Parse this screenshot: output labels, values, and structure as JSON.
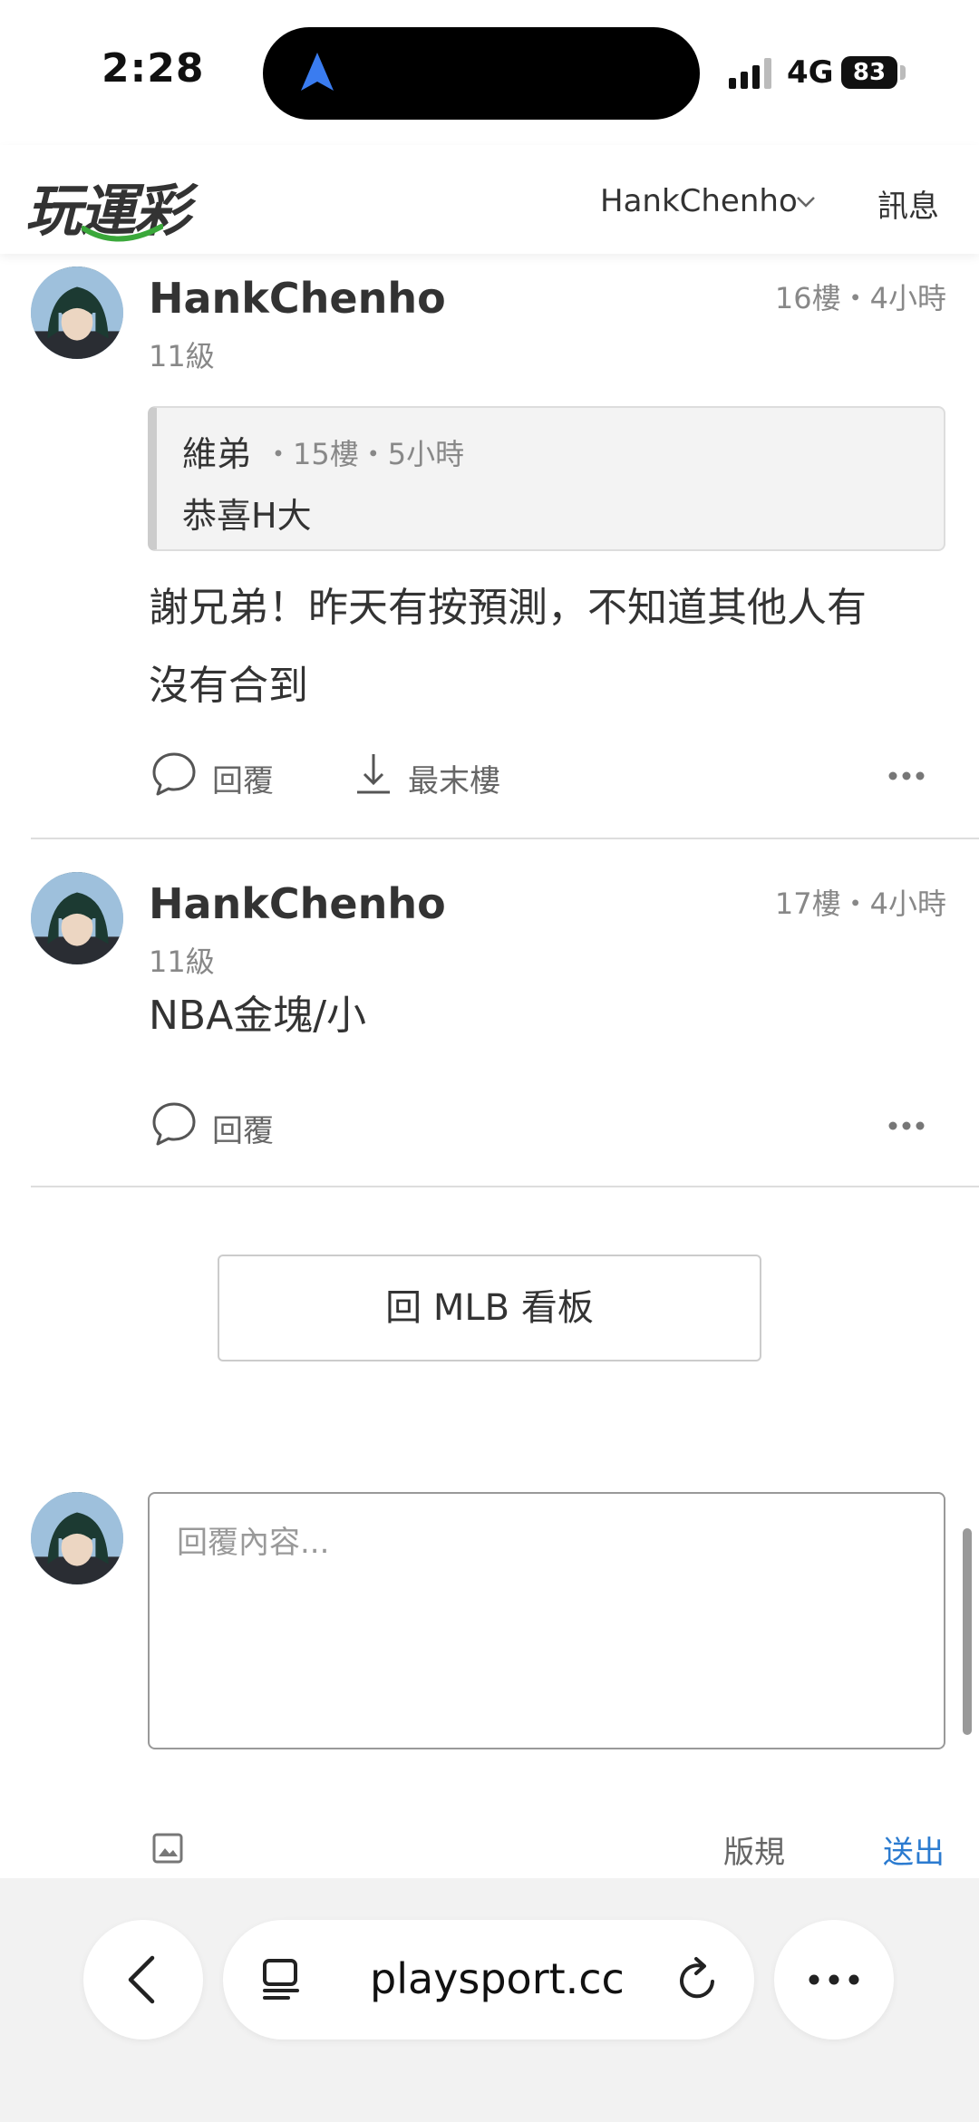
{
  "status_bar": {
    "time": "2:28",
    "network": "4G",
    "battery": "83"
  },
  "header": {
    "logo": "玩運彩",
    "username": "HankChenho",
    "messages": "訊息"
  },
  "posts": [
    {
      "author": "HankChenho",
      "meta": "16樓・4小時",
      "level": "11級",
      "quote": {
        "author": "維弟",
        "meta": "・15樓・5小時",
        "text": "恭喜H大"
      },
      "body_lines": [
        "謝兄弟！昨天有按預測，不知道其他人有",
        "沒有合到"
      ],
      "actions": {
        "reply": "回覆",
        "last_floor": "最末樓"
      }
    },
    {
      "author": "HankChenho",
      "meta": "17樓・4小時",
      "level": "11級",
      "body": "NBA金塊/小",
      "actions": {
        "reply": "回覆"
      }
    }
  ],
  "back_board_label": "回 MLB 看板",
  "reply_form": {
    "placeholder": "回覆內容...",
    "rules": "版規",
    "submit": "送出"
  },
  "browser": {
    "url": "playsport.cc"
  },
  "colors": {
    "accent_link": "#2b7bd0",
    "logo_green": "#3aa83a",
    "nav_arrow": "#3a7cf0"
  },
  "icons": [
    "navigation-arrow-icon",
    "signal-icon",
    "chevron-down-icon",
    "comment-icon",
    "download-icon",
    "more-icon",
    "image-icon",
    "back-icon",
    "tabs-icon",
    "reload-icon"
  ]
}
